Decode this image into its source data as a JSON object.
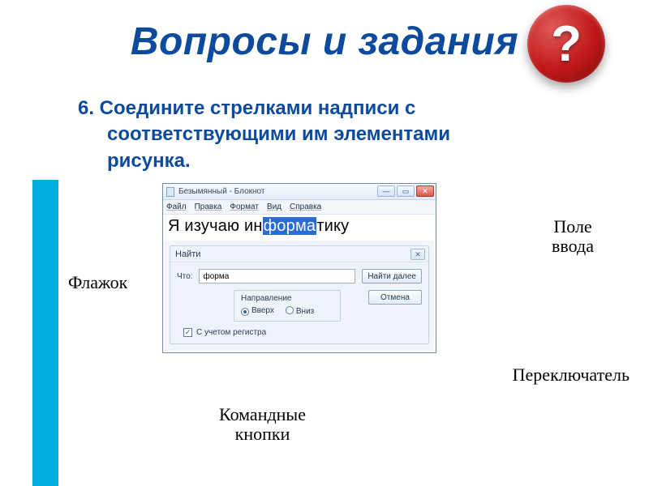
{
  "title": "Вопросы и задания",
  "qmark": "?",
  "instruction_line1": "6. Соедините стрелками надписи с",
  "instruction_line2": "соответствующими им элементами",
  "instruction_line3": "рисунка.",
  "callouts": {
    "input_field_l1": "Поле",
    "input_field_l2": "ввода",
    "flag": "Флажок",
    "switch": "Переключатель",
    "cmd_l1": "Командные",
    "cmd_l2": "кнопки"
  },
  "app": {
    "window_title": "Безымянный - Блокнот",
    "menu": {
      "file": "Файл",
      "edit": "Правка",
      "format": "Формат",
      "view": "Вид",
      "help": "Справка"
    },
    "editor": {
      "pre": "Я  изучаю  ин",
      "hl": "форма",
      "post": "тику"
    },
    "find": {
      "title": "Найти",
      "what_label": "Что:",
      "what_value": "форма",
      "find_next": "Найти далее",
      "cancel": "Отмена",
      "direction_label": "Направление",
      "dir_up": "Вверх",
      "dir_down": "Вниз",
      "case_label": "С учетом регистра"
    }
  }
}
